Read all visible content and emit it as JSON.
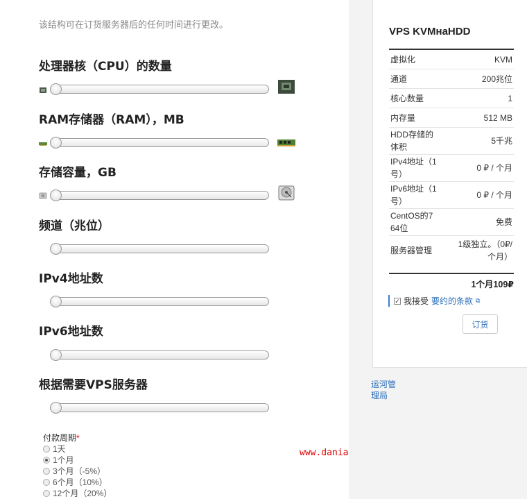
{
  "note": "该结构可在订货服务器后的任何时间进行更改。",
  "sections": [
    {
      "label": "处理器核（CPU）的数量"
    },
    {
      "label": "RAM存储器（RAM），MB"
    },
    {
      "label": "存储容量，GB"
    },
    {
      "label": "频道（兆位）"
    },
    {
      "label": "IPv4地址数"
    },
    {
      "label": "IPv6地址数"
    },
    {
      "label": "根据需要VPS服务器"
    }
  ],
  "payment": {
    "label": "付款周期",
    "required_mark": "*",
    "options": [
      {
        "label": "1天",
        "selected": false
      },
      {
        "label": "1个月",
        "selected": true
      },
      {
        "label": "3个月（-5%）",
        "selected": false
      },
      {
        "label": "6个月（10%）",
        "selected": false
      },
      {
        "label": "12个月（20%）",
        "selected": false
      }
    ]
  },
  "watermark": "www.daniao.org",
  "summary": {
    "title": "VPS KVMнаHDD",
    "rows": [
      {
        "key": "虚拟化",
        "value": "KVM"
      },
      {
        "key": "通道",
        "value": "200兆位"
      },
      {
        "key": "核心数量",
        "value": "1"
      },
      {
        "key": "内存量",
        "value": "512 MB"
      },
      {
        "key": "HDD存储的体积",
        "value": "5千兆"
      },
      {
        "key": "IPv4地址（1号）",
        "value": "0 ₽ / 个月"
      },
      {
        "key": "IPv6地址（1号）",
        "value": "0 ₽ / 个月"
      },
      {
        "key": "CentOS的7 64位",
        "value": "免费"
      },
      {
        "key": "服务器管理",
        "value": "1级独立。（0₽/ 个月）"
      }
    ],
    "total": "1个月109₽",
    "agree_text": "我接受",
    "agree_link": "要约的条款",
    "order_button": "订货"
  },
  "ops_link": "运河管理局"
}
